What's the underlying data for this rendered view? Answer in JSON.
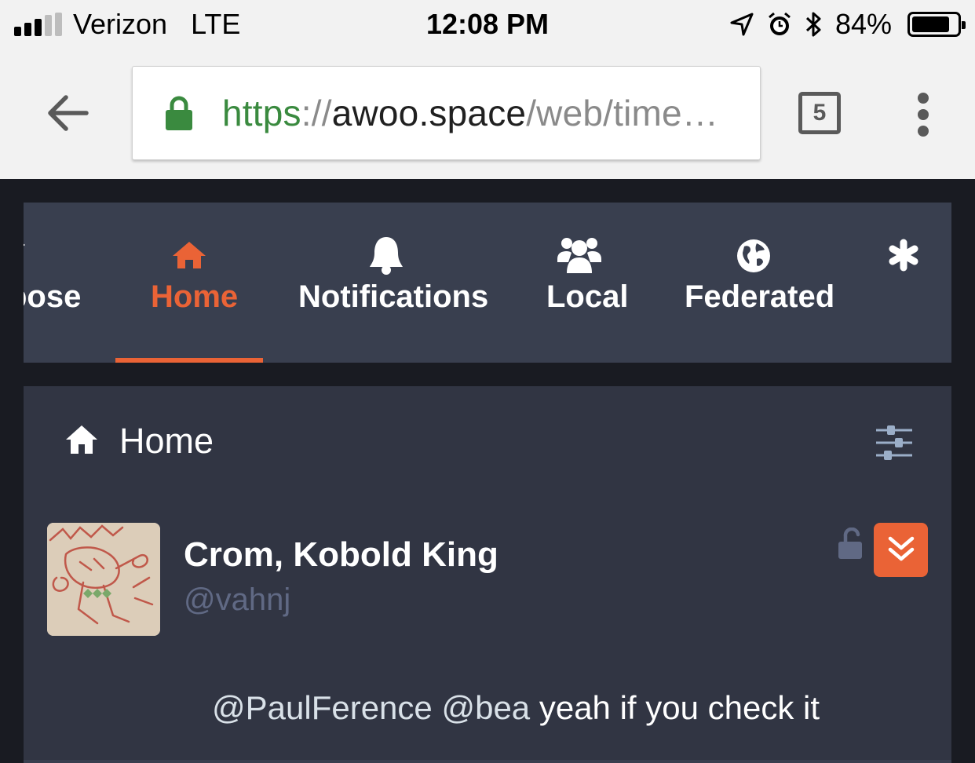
{
  "status_bar": {
    "carrier": "Verizon",
    "network": "LTE",
    "time": "12:08 PM",
    "battery_percent_text": "84%",
    "battery_level": 0.84,
    "icons": [
      "signal-icon",
      "location-arrow-icon",
      "alarm-icon",
      "bluetooth-icon",
      "battery-icon"
    ]
  },
  "browser": {
    "url_scheme": "https",
    "url_separator": "://",
    "url_host": "awoo.space",
    "url_path": "/web/time…",
    "tab_count": "5",
    "icons": [
      "back-arrow-icon",
      "lock-icon",
      "more-vert-icon"
    ]
  },
  "nav": {
    "tabs": [
      {
        "label": "pose",
        "icon": "pencil-icon"
      },
      {
        "label": "Home",
        "icon": "home-icon",
        "active": true
      },
      {
        "label": "Notifications",
        "icon": "bell-icon"
      },
      {
        "label": "Local",
        "icon": "users-icon"
      },
      {
        "label": "Federated",
        "icon": "globe-icon"
      },
      {
        "label": "",
        "icon": "asterisk-icon"
      }
    ]
  },
  "column": {
    "title": "Home",
    "icon": "home-icon",
    "settings_icon": "sliders-icon"
  },
  "status": {
    "display_name": "Crom, Kobold King",
    "acct": "@vahnj",
    "visibility_icon": "unlock-icon",
    "expand_icon": "double-chevron-down-icon",
    "mention1": "@PaulFerence",
    "mention2": "@bea",
    "text": "yeah if you check it"
  },
  "colors": {
    "accent": "#ea6336",
    "tabbar_bg": "#393f4f",
    "column_bg": "#313543",
    "page_bg": "#191b22",
    "muted": "#606984"
  }
}
